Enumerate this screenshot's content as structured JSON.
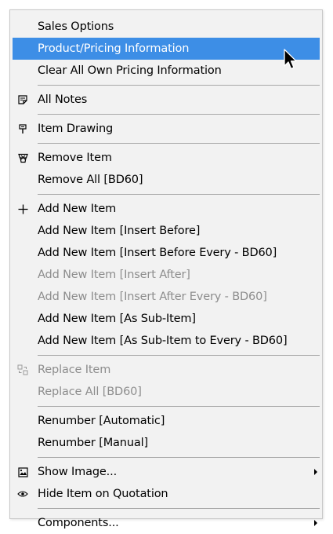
{
  "menu": {
    "items": [
      {
        "label": "Sales Options"
      },
      {
        "label": "Product/Pricing Information"
      },
      {
        "label": "Clear All Own Pricing Information"
      },
      {
        "label": "All Notes",
        "icon": "notes-icon"
      },
      {
        "label": "Item Drawing",
        "icon": "drawing-icon"
      },
      {
        "label": "Remove Item",
        "icon": "remove-icon"
      },
      {
        "label": "Remove All [BD60]"
      },
      {
        "label": "Add New Item",
        "icon": "plus-icon"
      },
      {
        "label": "Add New Item [Insert Before]"
      },
      {
        "label": "Add New Item [Insert Before Every - BD60]"
      },
      {
        "label": "Add New Item [Insert After]"
      },
      {
        "label": "Add New Item [Insert After Every - BD60]"
      },
      {
        "label": "Add New Item [As Sub-Item]"
      },
      {
        "label": "Add New Item [As Sub-Item to Every - BD60]"
      },
      {
        "label": "Replace Item",
        "icon": "replace-icon"
      },
      {
        "label": "Replace All [BD60]"
      },
      {
        "label": "Renumber [Automatic]"
      },
      {
        "label": "Renumber [Manual]"
      },
      {
        "label": "Show Image...",
        "icon": "image-icon"
      },
      {
        "label": "Hide Item on Quotation",
        "icon": "eye-icon"
      },
      {
        "label": "Components..."
      }
    ],
    "highlighted_item": "Product/Pricing Information",
    "disabled_items": [
      "Add New Item [Insert After]",
      "Add New Item [Insert After Every - BD60]",
      "Replace Item",
      "Replace All [BD60]"
    ],
    "submenu_items": [
      "Show Image...",
      "Components..."
    ]
  },
  "colors": {
    "background": "#f2f2f2",
    "highlight": "#3d8ee6",
    "text": "#000000",
    "disabled_text": "#8d8d8d",
    "separator": "#a9a9a9"
  }
}
